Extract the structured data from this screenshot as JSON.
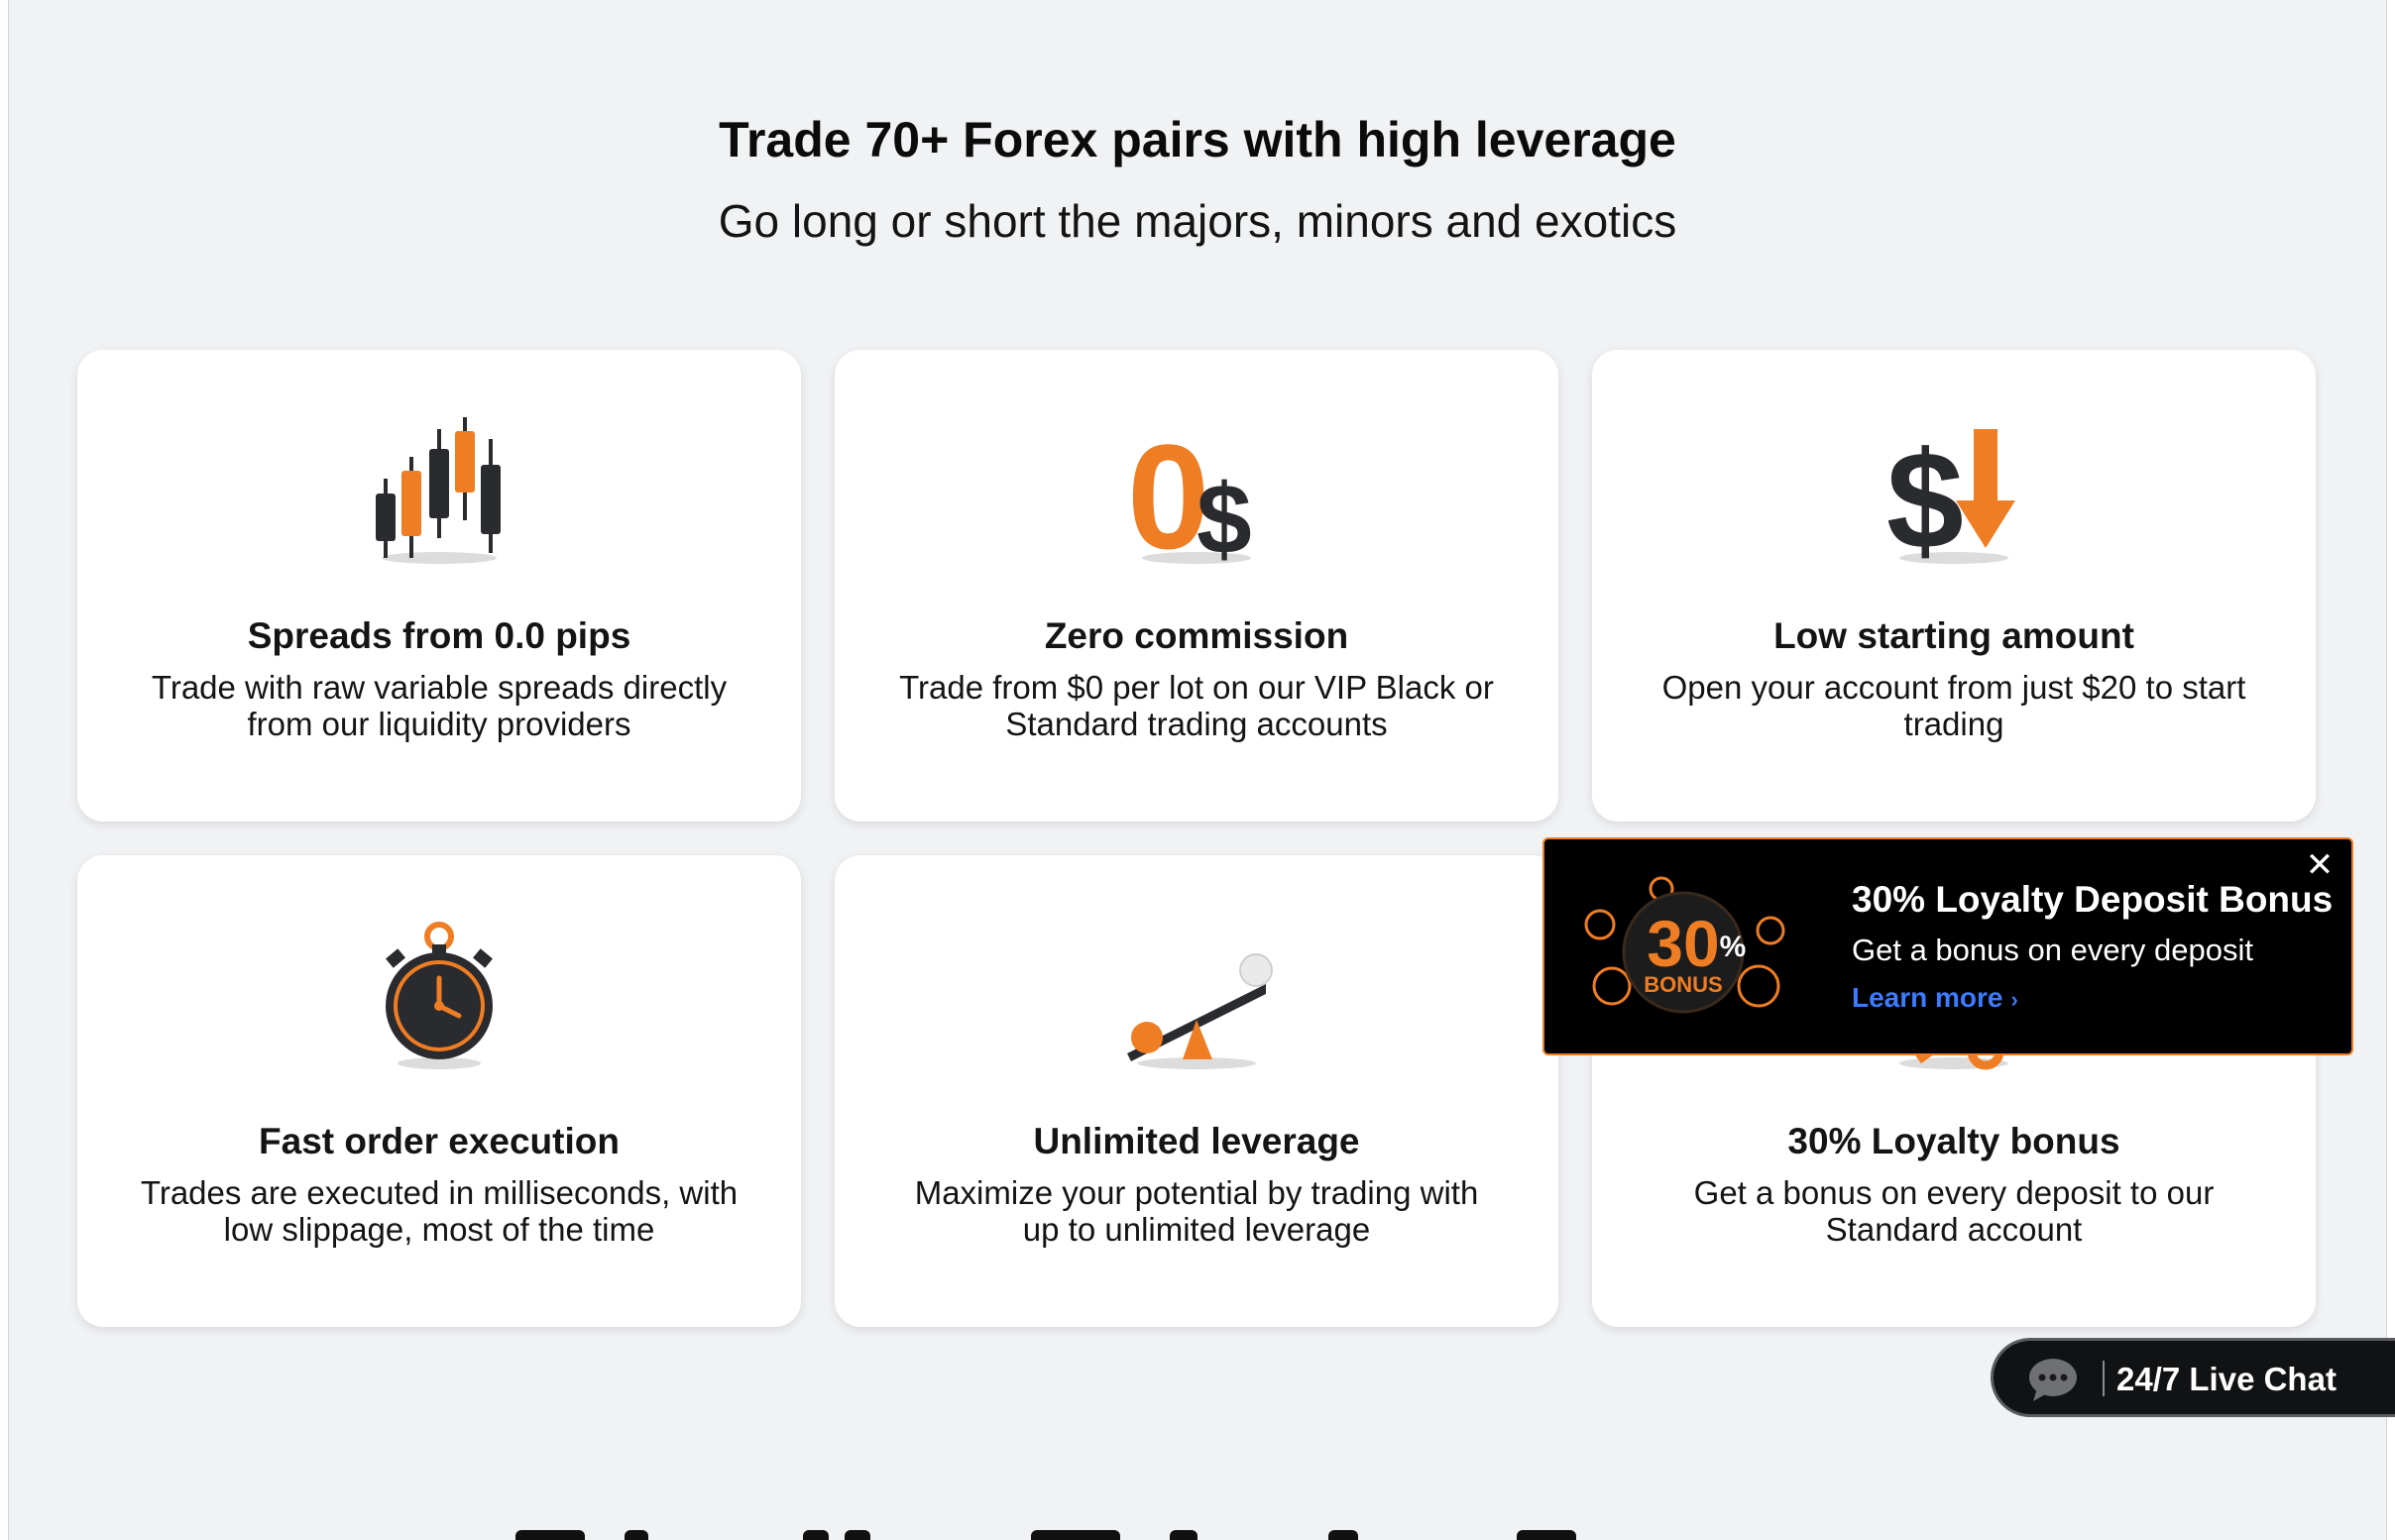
{
  "hero": {
    "title": "Trade 70+ Forex pairs with high leverage",
    "subtitle": "Go long or short the majors, minors and exotics"
  },
  "colors": {
    "accent": "#ee7d24",
    "dark": "#2a2b2e",
    "page_bg": "#f1f2f4",
    "link": "#3a7bff"
  },
  "features": [
    {
      "icon": "candlestick-chart-icon",
      "title": "Spreads from 0.0 pips",
      "description": "Trade with raw variable spreads directly from our liquidity providers"
    },
    {
      "icon": "zero-dollar-icon",
      "title": "Zero commission",
      "description": "Trade from $0 per lot on our VIP Black or Standard trading accounts"
    },
    {
      "icon": "dollar-down-arrow-icon",
      "title": "Low starting amount",
      "description": "Open your account from just $20 to start trading"
    },
    {
      "icon": "stopwatch-icon",
      "title": "Fast order execution",
      "description": "Trades are executed in milliseconds, with low slippage, most of the time"
    },
    {
      "icon": "seesaw-lever-icon",
      "title": "Unlimited leverage",
      "description": "Maximize your potential by trading with up to unlimited leverage"
    },
    {
      "icon": "percent-icon",
      "title": "30% Loyalty bonus",
      "description": "Get a bonus on every deposit to our Standard account"
    }
  ],
  "promo": {
    "badge_number": "30",
    "badge_percent": "%",
    "badge_word": "BONUS",
    "title": "30% Loyalty Deposit Bonus",
    "description": "Get a bonus on every deposit",
    "link_label": "Learn more",
    "link_chevron": "›",
    "close_glyph": "✕"
  },
  "chat": {
    "icon": "chat-bubble-icon",
    "label": "24/7 Live Chat"
  }
}
